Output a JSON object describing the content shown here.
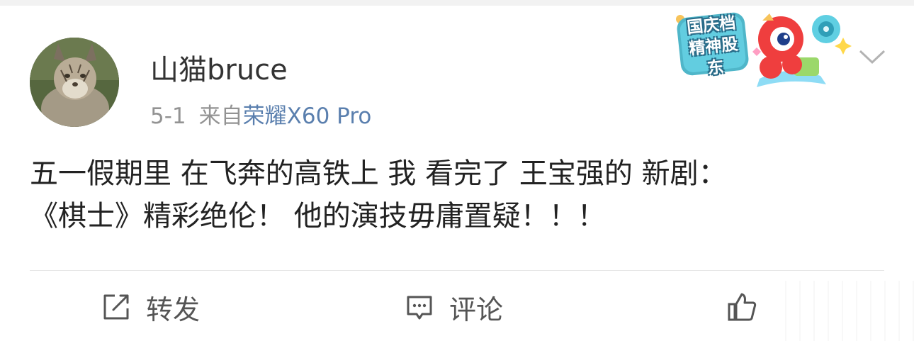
{
  "post": {
    "author": "山猫bruce",
    "date": "5-1",
    "source_prefix": "来自",
    "source_device": "荣耀X60 Pro",
    "content_line1": "五一假期里 在飞奔的高铁上 我 看完了 王宝强的 新剧：",
    "content_line2": "《棋士》精彩绝伦！ 他的演技毋庸置疑！！！"
  },
  "badge": {
    "line1": "国庆档",
    "line2": "精神股东"
  },
  "actions": {
    "repost": "转发",
    "comment": "评论",
    "like": "赞"
  },
  "icons": {
    "avatar": "lynx-avatar",
    "badge": "mascot-badge",
    "more": "chevron-down-icon",
    "repost": "repost-icon",
    "comment": "comment-icon",
    "like": "thumbs-up-icon"
  },
  "colors": {
    "link": "#5a7fae",
    "meta": "#939393",
    "text": "#222222"
  }
}
